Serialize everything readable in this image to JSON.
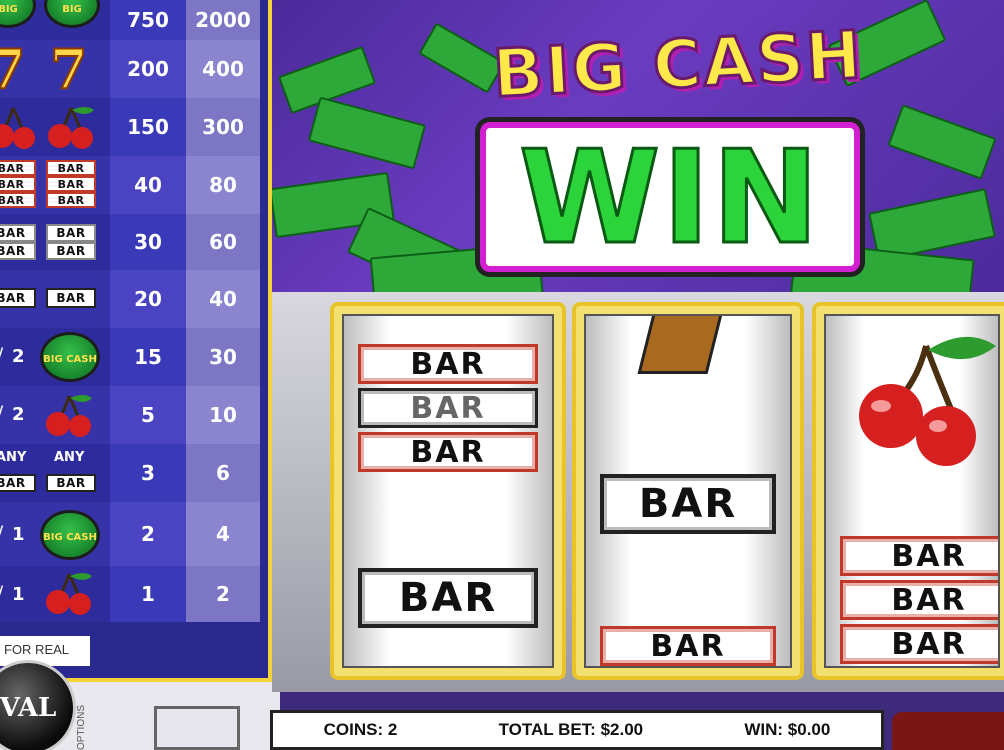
{
  "game": {
    "title_top": "BIG CASH",
    "title_bottom": "WIN",
    "symbol_logo": "BIG CASH WIN",
    "bar_label": "BAR"
  },
  "paytable": {
    "rows": [
      {
        "c1": "750",
        "c2": "2000"
      },
      {
        "c1": "200",
        "c2": "400"
      },
      {
        "c1": "150",
        "c2": "300"
      },
      {
        "c1": "40",
        "c2": "80"
      },
      {
        "c1": "30",
        "c2": "60"
      },
      {
        "c1": "20",
        "c2": "40"
      },
      {
        "c1": "15",
        "c2": "30"
      },
      {
        "c1": "5",
        "c2": "10"
      },
      {
        "c1": "3",
        "c2": "6"
      },
      {
        "c1": "2",
        "c2": "4"
      },
      {
        "c1": "1",
        "c2": "2"
      }
    ],
    "count_two": "2",
    "count_one": "1",
    "any_label": "ANY"
  },
  "play_for_real": "FOR REAL",
  "provider_logo": "VAL",
  "options_label": "OPTIONS",
  "info": {
    "coins": "COINS: 2",
    "total_bet": "TOTAL BET: $2.00",
    "win": "WIN: $0.00"
  },
  "colors": {
    "accent_yellow": "#f5d33a",
    "win_green": "#2bd43a",
    "logo_magenta": "#d11fd1",
    "paytable_blue": "#2a2a8e"
  },
  "icons": [
    "cherry-icon",
    "seven-icon",
    "bar-icon",
    "big-cash-win-icon"
  ]
}
